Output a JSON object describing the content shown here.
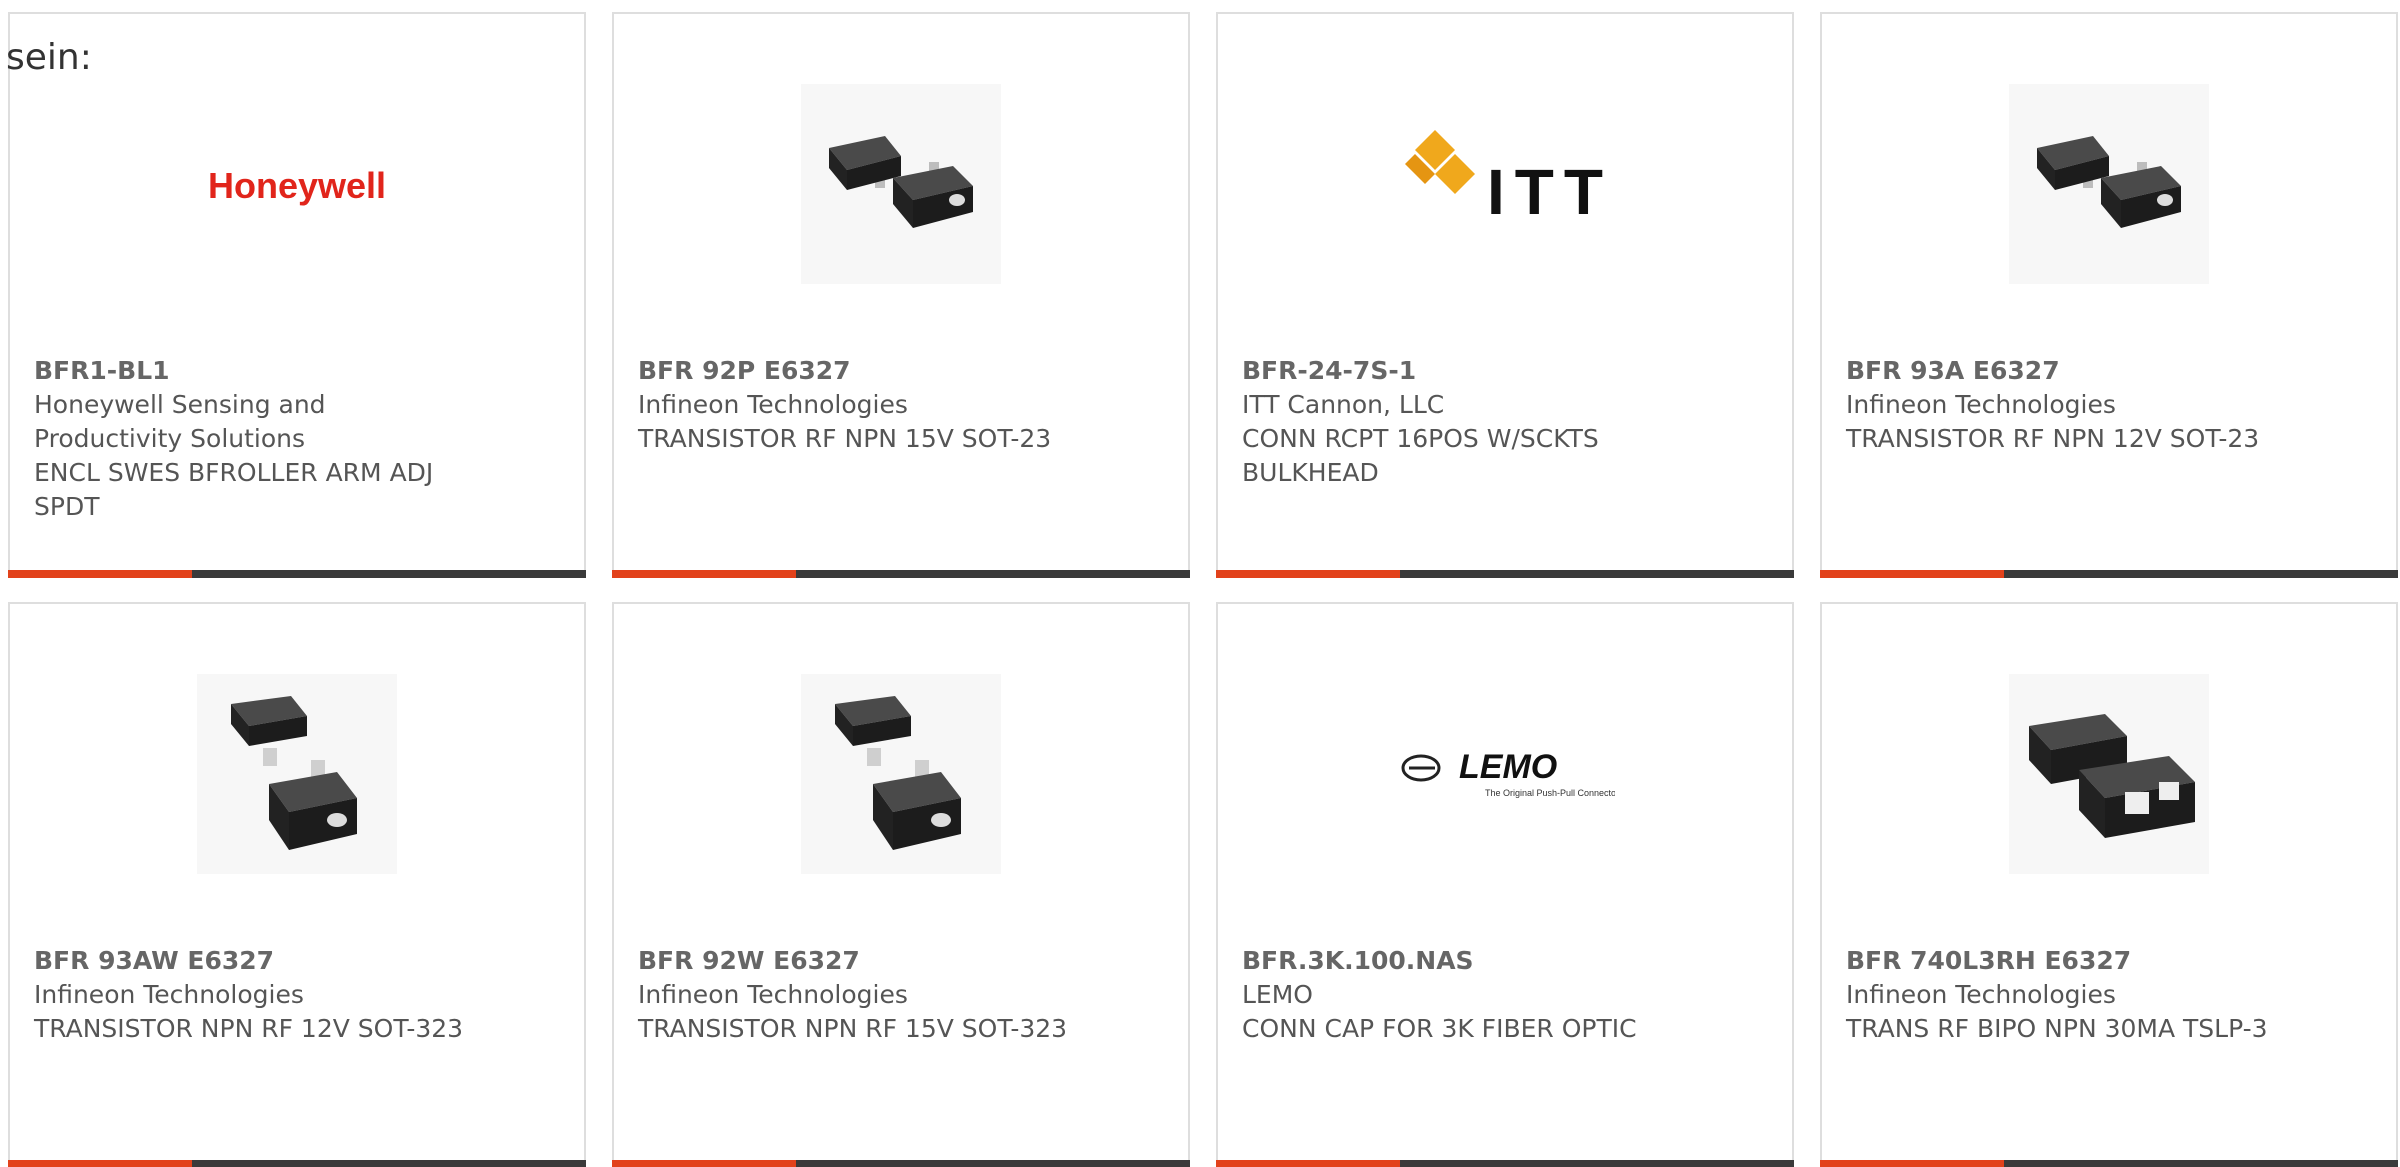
{
  "intro_text": "sein:",
  "accent_color": "#e2421b",
  "bar_color": "#3a3a3a",
  "cards": [
    {
      "part_number": "BFR1-BL1",
      "manufacturer": "Honeywell Sensing and Productivity Solutions",
      "description": "ENCL SWES BFROLLER ARM ADJ SPDT",
      "image": "honeywell-logo",
      "logo_text": "Honeywell"
    },
    {
      "part_number": "BFR 92P E6327",
      "manufacturer": "Infineon Technologies",
      "description": "TRANSISTOR RF NPN 15V SOT-23",
      "image": "sot23-transistor"
    },
    {
      "part_number": "BFR-24-7S-1",
      "manufacturer": "ITT Cannon, LLC",
      "description": "CONN RCPT 16POS W/SCKTS BULKHEAD",
      "image": "itt-logo",
      "logo_text": "ITT"
    },
    {
      "part_number": "BFR 93A E6327",
      "manufacturer": "Infineon Technologies",
      "description": "TRANSISTOR RF NPN 12V SOT-23",
      "image": "sot23-transistor"
    },
    {
      "part_number": "BFR 93AW E6327",
      "manufacturer": "Infineon Technologies",
      "description": "TRANSISTOR NPN RF 12V SOT-323",
      "image": "sot323-transistor"
    },
    {
      "part_number": "BFR 92W E6327",
      "manufacturer": "Infineon Technologies",
      "description": "TRANSISTOR NPN RF 15V SOT-323",
      "image": "sot323-transistor"
    },
    {
      "part_number": "BFR.3K.100.NAS",
      "manufacturer": "LEMO",
      "description": "CONN CAP FOR 3K FIBER OPTIC",
      "image": "lemo-logo",
      "logo_text": "LEMO",
      "logo_tagline": "The Original Push-Pull Connector"
    },
    {
      "part_number": "BFR 740L3RH E6327",
      "manufacturer": "Infineon Technologies",
      "description": "TRANS RF BIPO NPN 30MA TSLP-3",
      "image": "tslp3-transistor"
    }
  ]
}
